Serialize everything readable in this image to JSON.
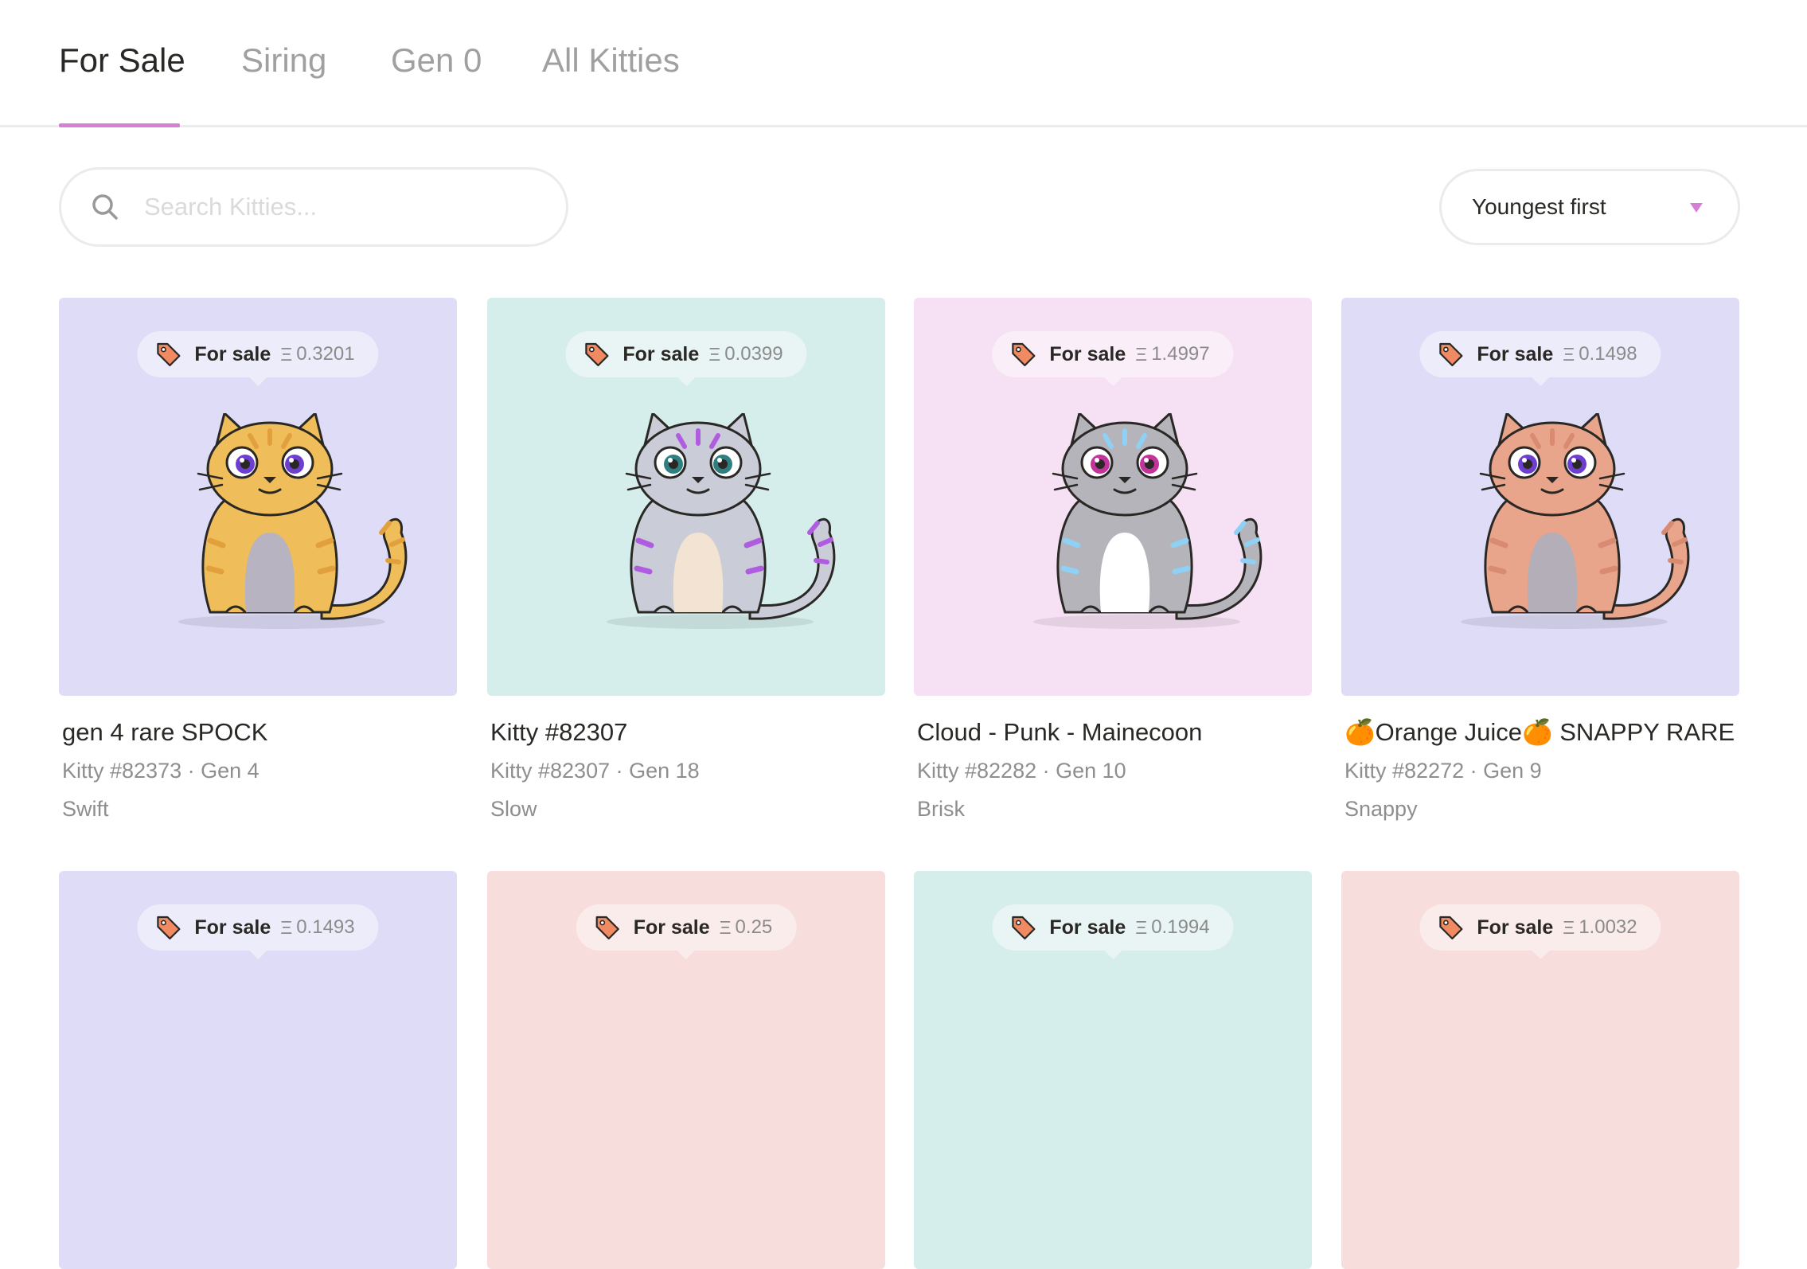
{
  "tabs": [
    {
      "label": "For Sale",
      "active": true
    },
    {
      "label": "Siring"
    },
    {
      "label": "Gen 0"
    },
    {
      "label": "All Kitties"
    }
  ],
  "search": {
    "placeholder": "Search Kitties..."
  },
  "sort": {
    "label": "Youngest first"
  },
  "badge_label": "For sale",
  "currency_symbol": "Ξ",
  "colors": {
    "accent": "#d77fd6",
    "tag_icon": "#f08a62"
  },
  "kitties": [
    {
      "name": "gen 4 rare SPOCK",
      "meta": "Kitty #82373 · Gen 4",
      "cooldown": "Swift",
      "price": "0.3201",
      "bg": "#dedcf7",
      "fur": "#efbd5a",
      "pattern": "#e2a03c",
      "belly": "#b8b3c0",
      "eye": "#6d3fd1"
    },
    {
      "name": "Kitty #82307",
      "meta": "Kitty #82307 · Gen 18",
      "cooldown": "Slow",
      "price": "0.0399",
      "bg": "#d5edeb",
      "fur": "#cacdd8",
      "pattern": "#b05ce0",
      "belly": "#f2e3d2",
      "eye": "#2f7f80"
    },
    {
      "name": "Cloud - Punk - Mainecoon",
      "meta": "Kitty #82282 · Gen 10",
      "cooldown": "Brisk",
      "price": "1.4997",
      "bg": "#f6e1f4",
      "fur": "#b4b4ba",
      "pattern": "#8fd0f5",
      "belly": "#ffffff",
      "eye": "#c2349a"
    },
    {
      "name": "🍊Orange Juice🍊 SNAPPY RARE",
      "meta": "Kitty #82272 · Gen 9",
      "cooldown": "Snappy",
      "price": "0.1498",
      "bg": "#dedcf7",
      "fur": "#e8a58b",
      "pattern": "#d88b70",
      "belly": "#b3aeb8",
      "eye": "#6d3fd1"
    },
    {
      "name": "",
      "meta": "",
      "cooldown": "",
      "price": "0.1493",
      "bg": "#dedcf7"
    },
    {
      "name": "",
      "meta": "",
      "cooldown": "",
      "price": "0.25",
      "bg": "#f7dddc"
    },
    {
      "name": "",
      "meta": "",
      "cooldown": "",
      "price": "0.1994",
      "bg": "#d5edeb"
    },
    {
      "name": "",
      "meta": "",
      "cooldown": "",
      "price": "1.0032",
      "bg": "#f7dddc"
    }
  ]
}
